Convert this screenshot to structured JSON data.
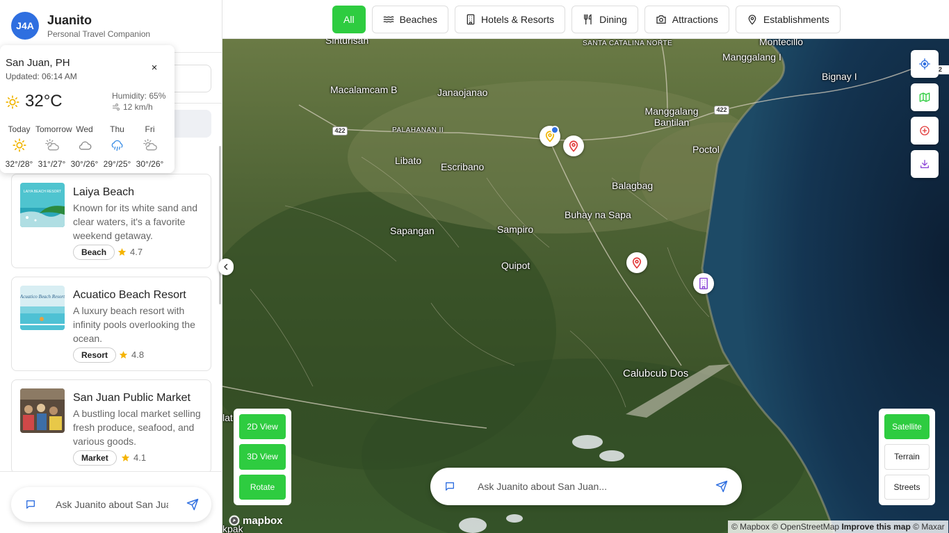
{
  "brand": {
    "logo": "J4A",
    "name": "Juanito",
    "tagline": "Personal Travel Companion"
  },
  "weather": {
    "location": "San Juan, PH",
    "updated": "Updated: 06:14 AM",
    "close": "×",
    "temp": "32°C",
    "humidity": "Humidity: 65%",
    "wind": "12 km/h",
    "forecast": [
      {
        "day": "Today",
        "icon": "sun-icon",
        "temps": "32°/28°"
      },
      {
        "day": "Tomorrow",
        "icon": "partly-cloudy-icon",
        "temps": "31°/27°"
      },
      {
        "day": "Wed",
        "icon": "cloud-icon",
        "temps": "30°/26°"
      },
      {
        "day": "Thu",
        "icon": "rain-icon",
        "temps": "29°/25°"
      },
      {
        "day": "Fri",
        "icon": "partly-cloudy-icon",
        "temps": "30°/26°"
      }
    ]
  },
  "places": [
    {
      "name": "Laiya Beach",
      "desc": "Known for its white sand and clear waters, it's a favorite weekend getaway.",
      "tag": "Beach",
      "rating": "4.7",
      "thumb_text": "LAIYA BEACH RESORT"
    },
    {
      "name": "Acuatico Beach Resort",
      "desc": "A luxury beach resort with infinity pools overlooking the ocean.",
      "tag": "Resort",
      "rating": "4.8",
      "thumb_text": "Acuatico Beach Resort"
    },
    {
      "name": "San Juan Public Market",
      "desc": "A bustling local market selling fresh produce, seafood, and various goods.",
      "tag": "Market",
      "rating": "4.1"
    }
  ],
  "sidebar_chat": {
    "placeholder": "Ask Juanito about San Juan..."
  },
  "tabs": [
    {
      "label": "All",
      "icon": "",
      "active": true
    },
    {
      "label": "Beaches",
      "icon": "waves-icon"
    },
    {
      "label": "Hotels & Resorts",
      "icon": "building-icon"
    },
    {
      "label": "Dining",
      "icon": "utensils-icon"
    },
    {
      "label": "Attractions",
      "icon": "camera-icon"
    },
    {
      "label": "Establishments",
      "icon": "map-pin-icon"
    }
  ],
  "map": {
    "labels": {
      "sinturisan": "Sinturisan",
      "santa_catalina": "SANTA CATALINA NORTE",
      "montecillo": "Montecillo",
      "manggalang_i": "Manggalang I",
      "bignay_i": "Bignay I",
      "macalamcam_b": "Macalamcam B",
      "janaojanao": "Janaojanao",
      "manggalang_bantilan": "Manggalang Bantilan",
      "palahanan": "PALAHANAN II",
      "libato": "Libato",
      "escribano": "Escribano",
      "poctol": "Poctol",
      "balagbag": "Balagbag",
      "buhay_na_sapa": "Buhay na Sapa",
      "sapangan": "Sapangan",
      "sampiro": "Sampiro",
      "quipot": "Quipot",
      "calubcub_dos": "Calubcub Dos",
      "edge_lat": "lat",
      "edge_kpak": "kpak"
    },
    "road_shields": [
      "422",
      "422"
    ],
    "edge_shield": "2",
    "view_controls": [
      "2D View",
      "3D View",
      "Rotate"
    ],
    "style_controls": [
      {
        "label": "Satellite",
        "active": true
      },
      {
        "label": "Terrain"
      },
      {
        "label": "Streets"
      }
    ],
    "chat_placeholder": "Ask Juanito about San Juan...",
    "logo": "mapbox",
    "attribution": {
      "mapbox": "© Mapbox",
      "osm": "© OpenStreetMap",
      "improve": "Improve this map",
      "maxar": "© Maxar"
    }
  },
  "colors": {
    "accent_green": "#2ecc40",
    "brand_blue": "#2f6fe0",
    "pin_red": "#e23b3b",
    "pin_yellow": "#f0b400",
    "pin_purple": "#8e4ad8"
  }
}
